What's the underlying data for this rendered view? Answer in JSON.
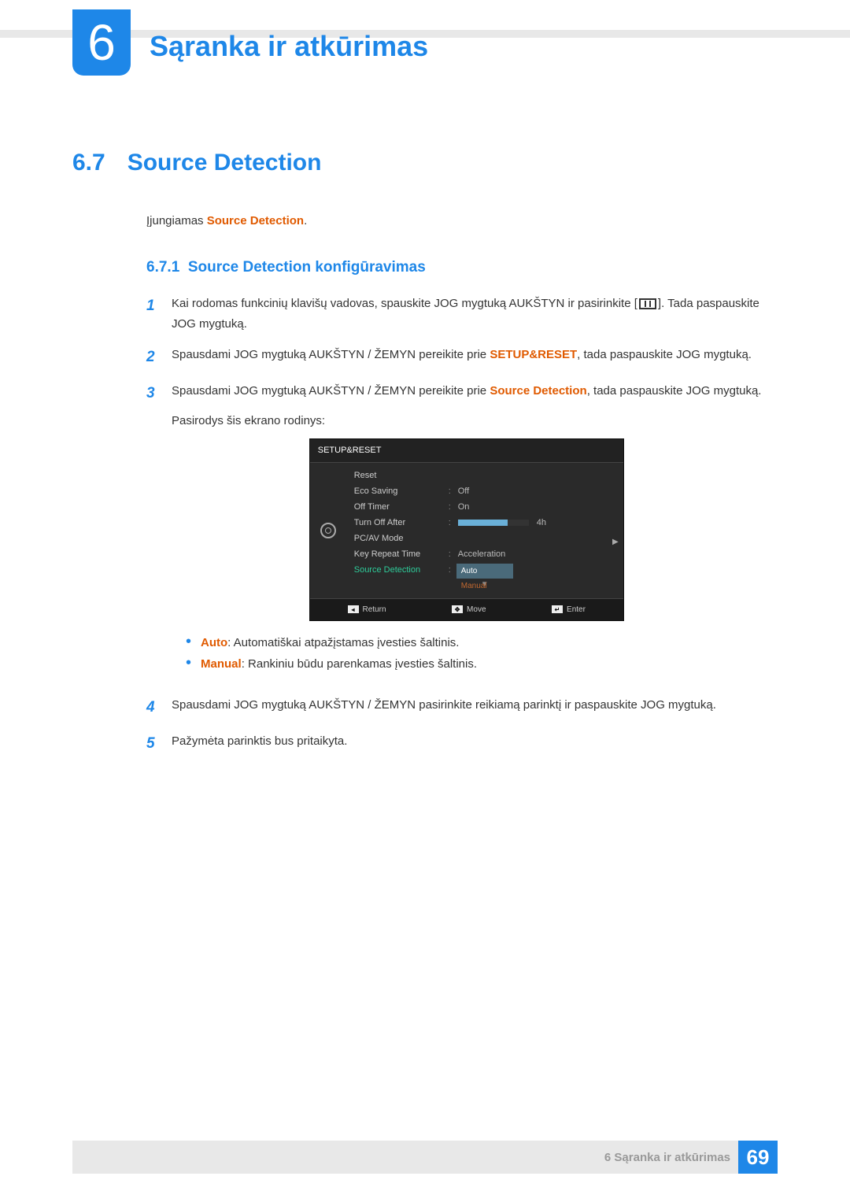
{
  "chapter": {
    "number": "6",
    "title": "Sąranka ir atkūrimas"
  },
  "section": {
    "number": "6.7",
    "title": "Source Detection"
  },
  "intro_prefix": "Įjungiamas ",
  "intro_highlight": "Source Detection",
  "intro_suffix": ".",
  "subsection": {
    "number": "6.7.1",
    "title": "Source Detection konfigūravimas"
  },
  "step1": {
    "num": "1",
    "t1": "Kai rodomas funkcinių klavišų vadovas, spauskite JOG mygtuką AUKŠTYN ir pasirinkite [",
    "t2": "]. Tada paspauskite JOG mygtuką."
  },
  "step2": {
    "num": "2",
    "pre": "Spausdami JOG mygtuką AUKŠTYN / ŽEMYN pereikite prie ",
    "hl": "SETUP&RESET",
    "post": ", tada paspauskite JOG mygtuką."
  },
  "step3": {
    "num": "3",
    "pre": "Spausdami JOG mygtuką AUKŠTYN / ŽEMYN pereikite prie ",
    "hl": "Source Detection",
    "post": ", tada paspauskite JOG mygtuką.",
    "after": "Pasirodys šis ekrano rodinys:"
  },
  "osd": {
    "title": "SETUP&RESET",
    "rows": {
      "reset": "Reset",
      "eco": "Eco Saving",
      "eco_val": "Off",
      "offtimer": "Off Timer",
      "offtimer_val": "On",
      "turnoff": "Turn Off After",
      "turnoff_val": "4h",
      "pcav": "PC/AV Mode",
      "keyrepeat": "Key Repeat Time",
      "keyrepeat_val": "Acceleration",
      "source": "Source Detection"
    },
    "dropdown": {
      "auto": "Auto",
      "manual": "Manual"
    },
    "footer": {
      "return": "Return",
      "move": "Move",
      "enter": "Enter"
    }
  },
  "bullet_auto": {
    "label": "Auto",
    "text": ": Automatiškai atpažįstamas įvesties šaltinis."
  },
  "bullet_manual": {
    "label": "Manual",
    "text": ": Rankiniu būdu parenkamas įvesties šaltinis."
  },
  "step4": {
    "num": "4",
    "text": "Spausdami JOG mygtuką AUKŠTYN / ŽEMYN pasirinkite reikiamą parinktį ir paspauskite JOG mygtuką."
  },
  "step5": {
    "num": "5",
    "text": "Pažymėta parinktis bus pritaikyta."
  },
  "footer": {
    "chapter_ref": "6 Sąranka ir atkūrimas",
    "page": "69"
  }
}
